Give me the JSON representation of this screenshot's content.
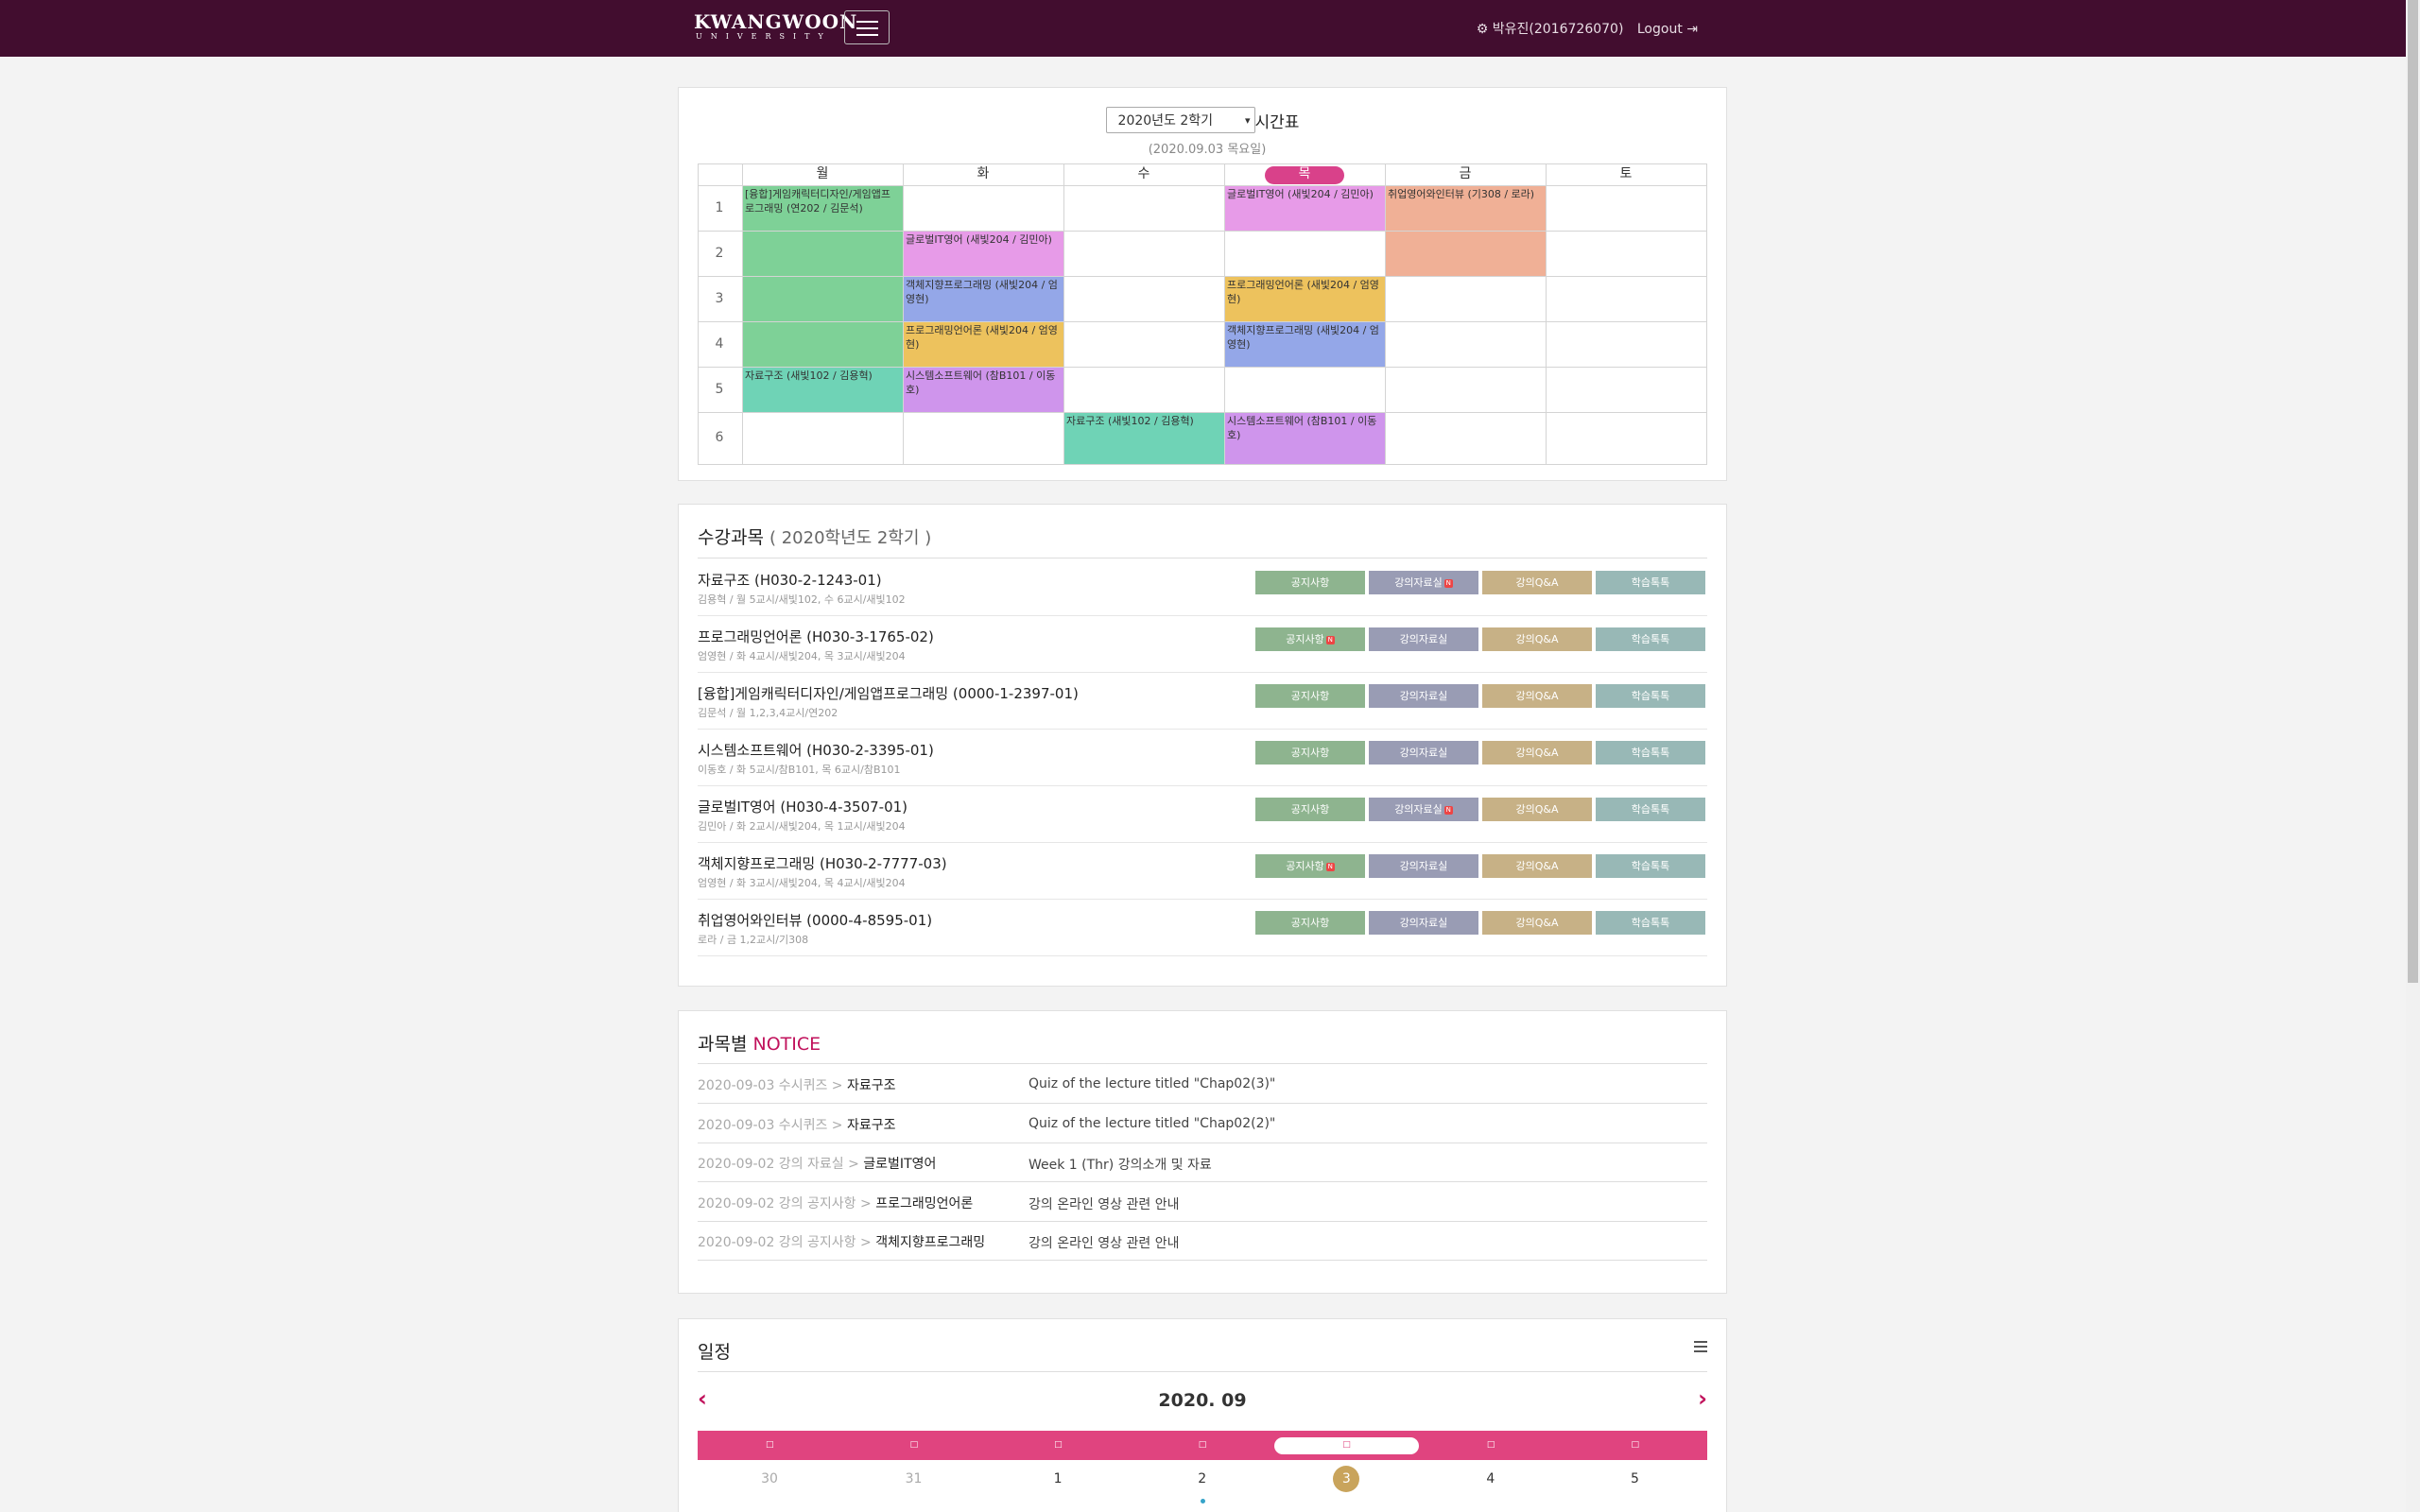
{
  "header": {
    "logo_main": "KWANGWOON",
    "logo_sub": "UNIVERSITY",
    "user": "⚙ 박유진(2016726070)",
    "logout": "Logout ⇥"
  },
  "timetable": {
    "semester_select": "2020년도 2학기",
    "title": "시간표",
    "date": "(2020.09.03 목요일)",
    "days": [
      "월",
      "화",
      "수",
      "목",
      "금",
      "토"
    ],
    "periods": [
      "1",
      "2",
      "3",
      "4",
      "5",
      "6"
    ],
    "events": [
      {
        "text": "[융합]게임캐릭터디자인/게임앱프로그래밍 (연202 / 김문석)",
        "day": 0,
        "start": 1,
        "span": 4,
        "color": "#7ed197"
      },
      {
        "text": "자료구조 (새빛102 / 김용혁)",
        "day": 0,
        "start": 5,
        "span": 1,
        "color": "#6fd3b6"
      },
      {
        "text": "글로벌IT영어 (새빛204 / 김민아)",
        "day": 1,
        "start": 2,
        "span": 1,
        "color": "#e79be8"
      },
      {
        "text": "객체지향프로그래밍 (새빛204 / 엄영현)",
        "day": 1,
        "start": 3,
        "span": 1,
        "color": "#94a7e8"
      },
      {
        "text": "프로그래밍언어론 (새빛204 / 엄영현)",
        "day": 1,
        "start": 4,
        "span": 1,
        "color": "#edc25d"
      },
      {
        "text": "시스템소프트웨어 (참B101 / 이동호)",
        "day": 1,
        "start": 5,
        "span": 1,
        "color": "#cf95ec"
      },
      {
        "text": "자료구조 (새빛102 / 김용혁)",
        "day": 2,
        "start": 6,
        "span": 1,
        "color": "#6fd3b6"
      },
      {
        "text": "글로벌IT영어 (새빛204 / 김민아)",
        "day": 3,
        "start": 1,
        "span": 1,
        "color": "#e79be8"
      },
      {
        "text": "프로그래밍언어론 (새빛204 / 엄영현)",
        "day": 3,
        "start": 3,
        "span": 1,
        "color": "#edc25d"
      },
      {
        "text": "객체지향프로그래밍 (새빛204 / 엄영현)",
        "day": 3,
        "start": 4,
        "span": 1,
        "color": "#94a7e8"
      },
      {
        "text": "시스템소프트웨어 (참B101 / 이동호)",
        "day": 3,
        "start": 6,
        "span": 1,
        "color": "#cf95ec"
      },
      {
        "text": "취업영어와인터뷰 (기308 / 로라)",
        "day": 4,
        "start": 1,
        "span": 2,
        "color": "#f0b096"
      }
    ]
  },
  "courses": {
    "title": "수강과목",
    "subtitle": "( 2020학년도 2학기 )",
    "buttons": [
      "공지사항",
      "강의자료실",
      "강의Q&A",
      "학습톡톡"
    ],
    "items": [
      {
        "name": "자료구조 (H030-2-1243-01)",
        "meta": "김용혁 / 월 5교시/새빛102, 수 6교시/새빛102",
        "new": [
          false,
          true,
          false,
          false
        ]
      },
      {
        "name": "프로그래밍언어론 (H030-3-1765-02)",
        "meta": "엄영현 / 화 4교시/새빛204, 목 3교시/새빛204",
        "new": [
          true,
          false,
          false,
          false
        ]
      },
      {
        "name": "[융합]게임캐릭터디자인/게임앱프로그래밍 (0000-1-2397-01)",
        "meta": "김문석 / 월 1,2,3,4교시/연202",
        "new": [
          false,
          false,
          false,
          false
        ]
      },
      {
        "name": "시스템소프트웨어 (H030-2-3395-01)",
        "meta": "이동호 / 화 5교시/참B101, 목 6교시/참B101",
        "new": [
          false,
          false,
          false,
          false
        ]
      },
      {
        "name": "글로벌IT영어 (H030-4-3507-01)",
        "meta": "김민아 / 화 2교시/새빛204, 목 1교시/새빛204",
        "new": [
          false,
          true,
          false,
          false
        ]
      },
      {
        "name": "객체지향프로그래밍 (H030-2-7777-03)",
        "meta": "엄영현 / 화 3교시/새빛204, 목 4교시/새빛204",
        "new": [
          true,
          false,
          false,
          false
        ]
      },
      {
        "name": "취업영어와인터뷰 (0000-4-8595-01)",
        "meta": "로라 / 금 1,2교시/기308",
        "new": [
          false,
          false,
          false,
          false
        ]
      }
    ]
  },
  "notice": {
    "title_a": "과목별",
    "title_b": "NOTICE",
    "items": [
      {
        "date": "2020-09-03",
        "board": "수시퀴즈 >",
        "course": "자료구조",
        "text": "Quiz of the lecture titled \"Chap02(3)\""
      },
      {
        "date": "2020-09-03",
        "board": "수시퀴즈 >",
        "course": "자료구조",
        "text": "Quiz of the lecture titled \"Chap02(2)\""
      },
      {
        "date": "2020-09-02",
        "board": "강의 자료실 >",
        "course": "글로벌IT영어",
        "text": "Week 1 (Thr) 강의소개 및 자료"
      },
      {
        "date": "2020-09-02",
        "board": "강의 공지사항 >",
        "course": "프로그래밍언어론",
        "text": "강의 온라인 영상 관련 안내"
      },
      {
        "date": "2020-09-02",
        "board": "강의 공지사항 >",
        "course": "객체지향프로그래밍",
        "text": "강의 온라인 영상 관련 안내"
      }
    ]
  },
  "schedule": {
    "title": "일정",
    "month": "2020. 09",
    "weekday_glyphs": [
      "□",
      "□",
      "□",
      "□",
      "□",
      "□",
      "□"
    ],
    "today_index": 4,
    "days": [
      "30",
      "31",
      "1",
      "2",
      "3",
      "4",
      "5"
    ],
    "muted": [
      true,
      true,
      false,
      false,
      false,
      false,
      false
    ],
    "event_dots": [
      false,
      false,
      false,
      true,
      false,
      false,
      false
    ]
  },
  "colors": {
    "header_bg": "#420d2f",
    "accent": "#c1125c",
    "calendar_bar": "#e0447f"
  }
}
